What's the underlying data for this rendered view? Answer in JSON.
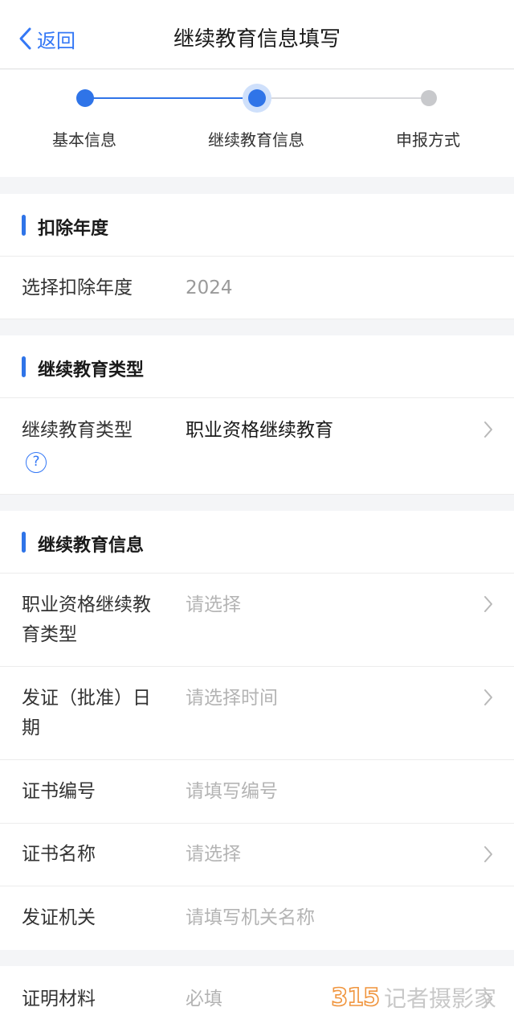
{
  "nav": {
    "back_label": "返回",
    "title": "继续教育信息填写"
  },
  "steps": [
    {
      "label": "基本信息",
      "state": "done"
    },
    {
      "label": "继续教育信息",
      "state": "current"
    },
    {
      "label": "申报方式",
      "state": "pending"
    }
  ],
  "sections": {
    "deduction_year": {
      "title": "扣除年度",
      "select_label": "选择扣除年度",
      "select_value": "2024"
    },
    "edu_type": {
      "title": "继续教育类型",
      "type_label": "继续教育类型",
      "type_value": "职业资格继续教育"
    },
    "edu_info": {
      "title": "继续教育信息",
      "qual_type_label": "职业资格继续教育类型",
      "qual_type_placeholder": "请选择",
      "issue_date_label": "发证（批准）日期",
      "issue_date_placeholder": "请选择时间",
      "cert_no_label": "证书编号",
      "cert_no_placeholder": "请填写编号",
      "cert_name_label": "证书名称",
      "cert_name_placeholder": "请选择",
      "issuer_label": "发证机关",
      "issuer_placeholder": "请填写机关名称"
    },
    "proof": {
      "label": "证明材料",
      "placeholder": "必填"
    }
  },
  "watermark": {
    "num": "315",
    "text": "记者摄影家"
  },
  "colors": {
    "accent": "#2f74e8",
    "link": "#3478f6",
    "pending": "#c8c9cc",
    "watermark": "#f0953e"
  }
}
